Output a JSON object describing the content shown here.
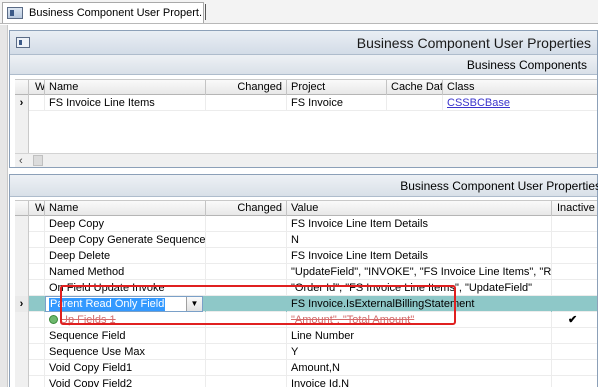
{
  "tab": {
    "label": "Business Component User Propert..."
  },
  "window": {
    "title": "Business Component User Properties"
  },
  "business_components": {
    "title": "Business Components",
    "columns": [
      "W",
      "Name",
      "Changed",
      "Project",
      "Cache Data",
      "Class"
    ],
    "rows": [
      {
        "marker": "›",
        "w": "",
        "name": "FS Invoice Line Items",
        "changed": "",
        "project": "FS Invoice",
        "cache": "",
        "class": "CSSBCBase"
      }
    ],
    "scroll_left": "‹"
  },
  "user_props": {
    "title": "Business Component User Properties",
    "columns": [
      "W",
      "Name",
      "Changed",
      "Value",
      "Inactive"
    ],
    "rows": [
      {
        "name": "Deep Copy",
        "value": "FS Invoice Line Item Details",
        "inactive": ""
      },
      {
        "name": "Deep Copy Generate Sequence",
        "value": "N",
        "inactive": ""
      },
      {
        "name": "Deep Delete",
        "value": "FS Invoice Line Item Details",
        "inactive": ""
      },
      {
        "name": "Named Method",
        "value": "\"UpdateField\", \"INVOKE\", \"FS Invoice Line Items\", \"Refres",
        "inactive": ""
      },
      {
        "name": "On Field Update Invoke",
        "value": "\"Order Id\", \"FS Invoice Line Items\", \"UpdateField\"",
        "inactive": ""
      },
      {
        "marker": "›",
        "name": "Parent Read Only Field",
        "value": "FS Invoice.IsExternalBillingStatement",
        "inactive": ""
      },
      {
        "name": "Up Fields 1",
        "value": "\"Amount\", \"Total Amount\"",
        "inactive": "✔"
      },
      {
        "name": "Sequence Field",
        "value": "Line Number",
        "inactive": ""
      },
      {
        "name": "Sequence Use Max",
        "value": "Y",
        "inactive": ""
      },
      {
        "name": "Void Copy Field1",
        "value": "Amount,N",
        "inactive": ""
      },
      {
        "name": "Void Copy Field2",
        "value": "Invoice Id,N",
        "inactive": ""
      }
    ]
  }
}
